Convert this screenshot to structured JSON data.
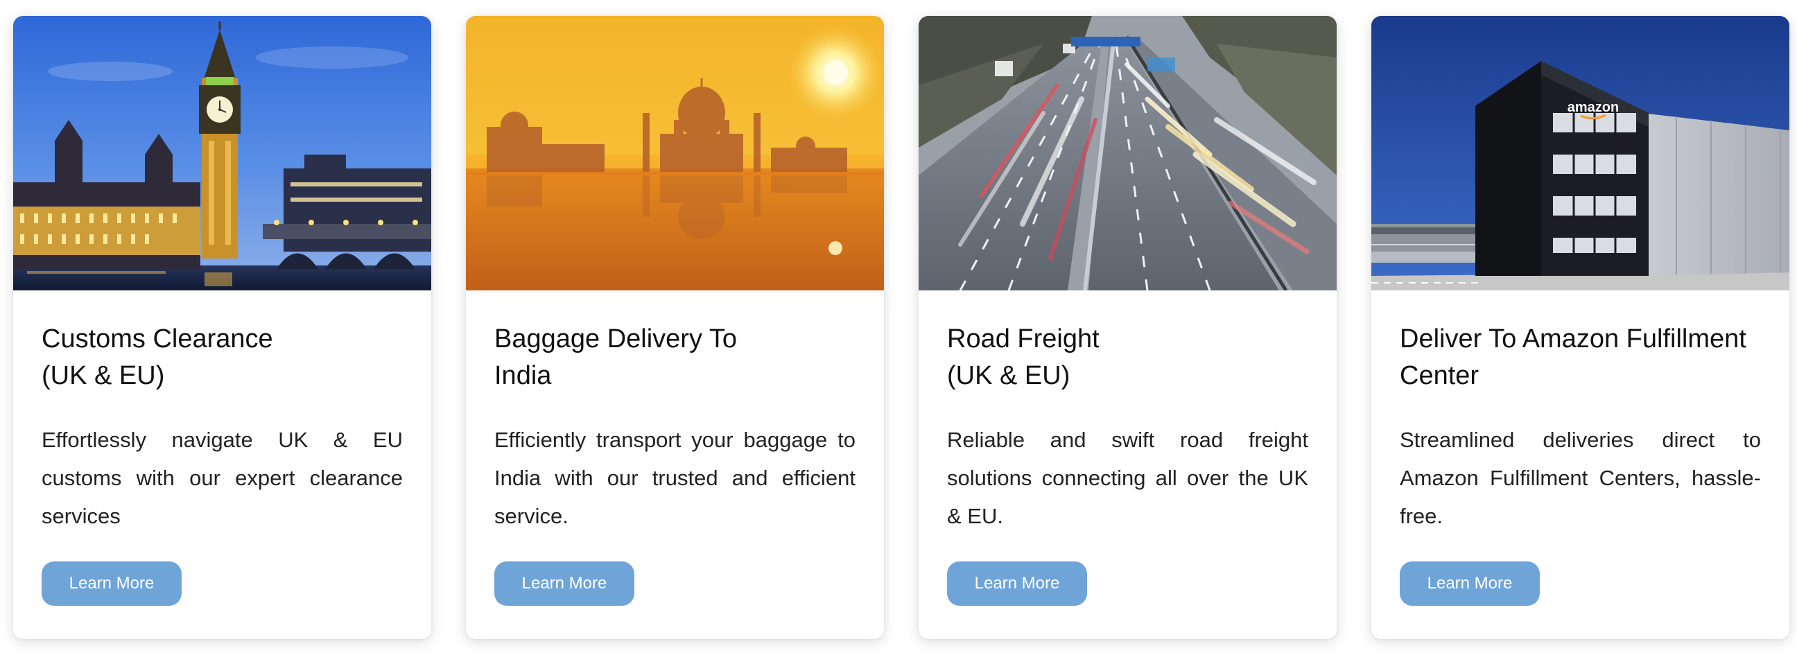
{
  "cards": [
    {
      "title_line1": "Customs Clearance",
      "title_line2": "(UK & EU)",
      "description": "Effortlessly navigate UK & EU customs with our expert clearance services",
      "button_label": "Learn More"
    },
    {
      "title_line1": "Baggage Delivery To",
      "title_line2": "India",
      "description": "Efficiently transport your baggage to India with our trusted and efficient service.",
      "button_label": "Learn More"
    },
    {
      "title_line1": "Road Freight",
      "title_line2": "(UK & EU)",
      "description": "Reliable and swift road freight solutions connecting all over the UK & EU.",
      "button_label": "Learn More"
    },
    {
      "title_line1": "Deliver To Amazon Fulfillment",
      "title_line2": "Center",
      "description": "Streamlined deliveries direct to Amazon Fulfillment Centers, hassle-free.",
      "button_label": "Learn More"
    }
  ],
  "amazon_sign": "amazon",
  "colors": {
    "button": "#6fa4d9",
    "title": "#111111",
    "text": "#222222"
  }
}
